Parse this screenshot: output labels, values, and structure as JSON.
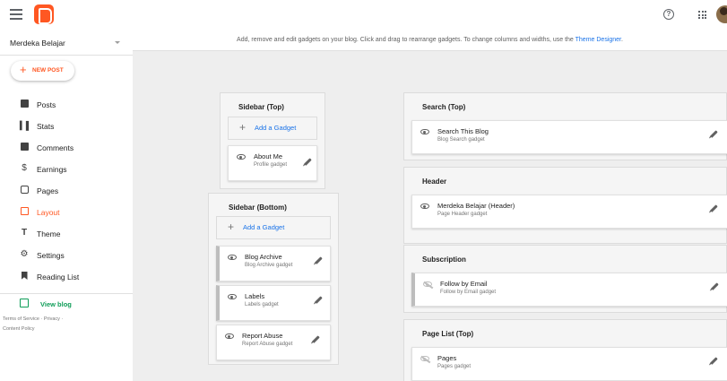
{
  "header": {
    "app_logo": "blogger-logo-icon",
    "menu_icon": "hamburger-menu-icon",
    "help_icon": "help-circle-icon",
    "apps_icon": "apps-grid-icon"
  },
  "sidebar": {
    "blog_name": "Merdeka Belajar",
    "new_post": "NEW POST",
    "items": [
      {
        "label": "Posts",
        "icon": "posts-icon"
      },
      {
        "label": "Stats",
        "icon": "stats-icon"
      },
      {
        "label": "Comments",
        "icon": "comments-icon"
      },
      {
        "label": "Earnings",
        "icon": "dollar-icon"
      },
      {
        "label": "Pages",
        "icon": "pages-icon"
      },
      {
        "label": "Layout",
        "icon": "layout-icon",
        "active": true
      },
      {
        "label": "Theme",
        "icon": "theme-icon"
      },
      {
        "label": "Settings",
        "icon": "settings-icon"
      },
      {
        "label": "Reading List",
        "icon": "bookmark-icon"
      }
    ],
    "view_blog": "View blog",
    "footer": {
      "terms": "Terms of Service",
      "sep": " · ",
      "privacy": "Privacy",
      "sep2": " · ",
      "content_policy": "Content Policy"
    }
  },
  "main": {
    "info_text": "Add, remove and edit gadgets on your blog. Click and drag to rearrange gadgets. To change columns and widths, use the ",
    "info_link": "Theme Designer",
    "info_end": ".",
    "add_gadget": "Add a Gadget",
    "sections": {
      "sidebar_top": {
        "title": "Sidebar (Top)",
        "gadgets": [
          {
            "name": "About Me",
            "type": "Profile gadget"
          }
        ]
      },
      "sidebar_bottom": {
        "title": "Sidebar (Bottom)",
        "gadgets": [
          {
            "name": "Blog Archive",
            "type": "Blog Archive gadget"
          },
          {
            "name": "Labels",
            "type": "Labels gadget"
          },
          {
            "name": "Report Abuse",
            "type": "Report Abuse gadget"
          }
        ]
      },
      "search_top": {
        "title": "Search (Top)",
        "gadgets": [
          {
            "name": "Search This Blog",
            "type": "Blog Search gadget"
          }
        ]
      },
      "header": {
        "title": "Header",
        "gadgets": [
          {
            "name": "Merdeka Belajar (Header)",
            "type": "Page Header gadget"
          }
        ]
      },
      "subscription": {
        "title": "Subscription",
        "gadgets": [
          {
            "name": "Follow by Email",
            "type": "Follow by Email gadget"
          }
        ]
      },
      "page_list_top": {
        "title": "Page List (Top)",
        "gadgets": [
          {
            "name": "Pages",
            "type": "Pages gadget"
          }
        ]
      }
    }
  },
  "colors": {
    "brand": "#ff5722",
    "link": "#1a73e8",
    "view_blog": "#0f9d58",
    "canvas": "#eeeeee"
  }
}
